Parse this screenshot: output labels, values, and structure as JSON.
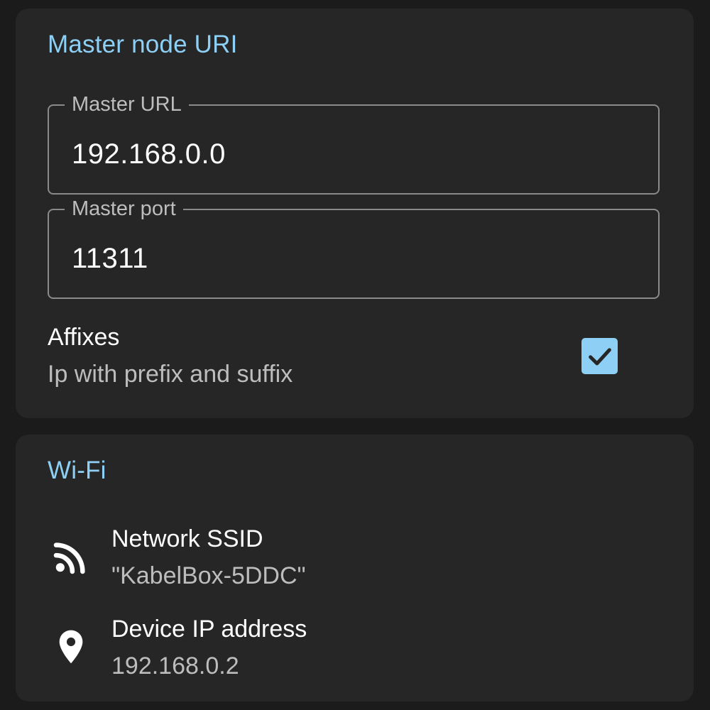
{
  "master": {
    "section_title": "Master node URI",
    "url_field": {
      "label": "Master URL",
      "value": "192.168.0.0"
    },
    "port_field": {
      "label": "Master port",
      "value": "11311"
    },
    "affixes": {
      "title": "Affixes",
      "summary": "Ip with prefix and suffix",
      "checked": true
    }
  },
  "wifi": {
    "section_title": "Wi-Fi",
    "ssid": {
      "title": "Network SSID",
      "value": "\"KabelBox-5DDC\"",
      "icon": "wifi-signal-icon"
    },
    "ip": {
      "title": "Device IP address",
      "value": "192.168.0.2",
      "icon": "location-pin-icon"
    }
  },
  "colors": {
    "accent": "#8ecff5",
    "background": "#1b1b1b",
    "card": "#262626"
  }
}
